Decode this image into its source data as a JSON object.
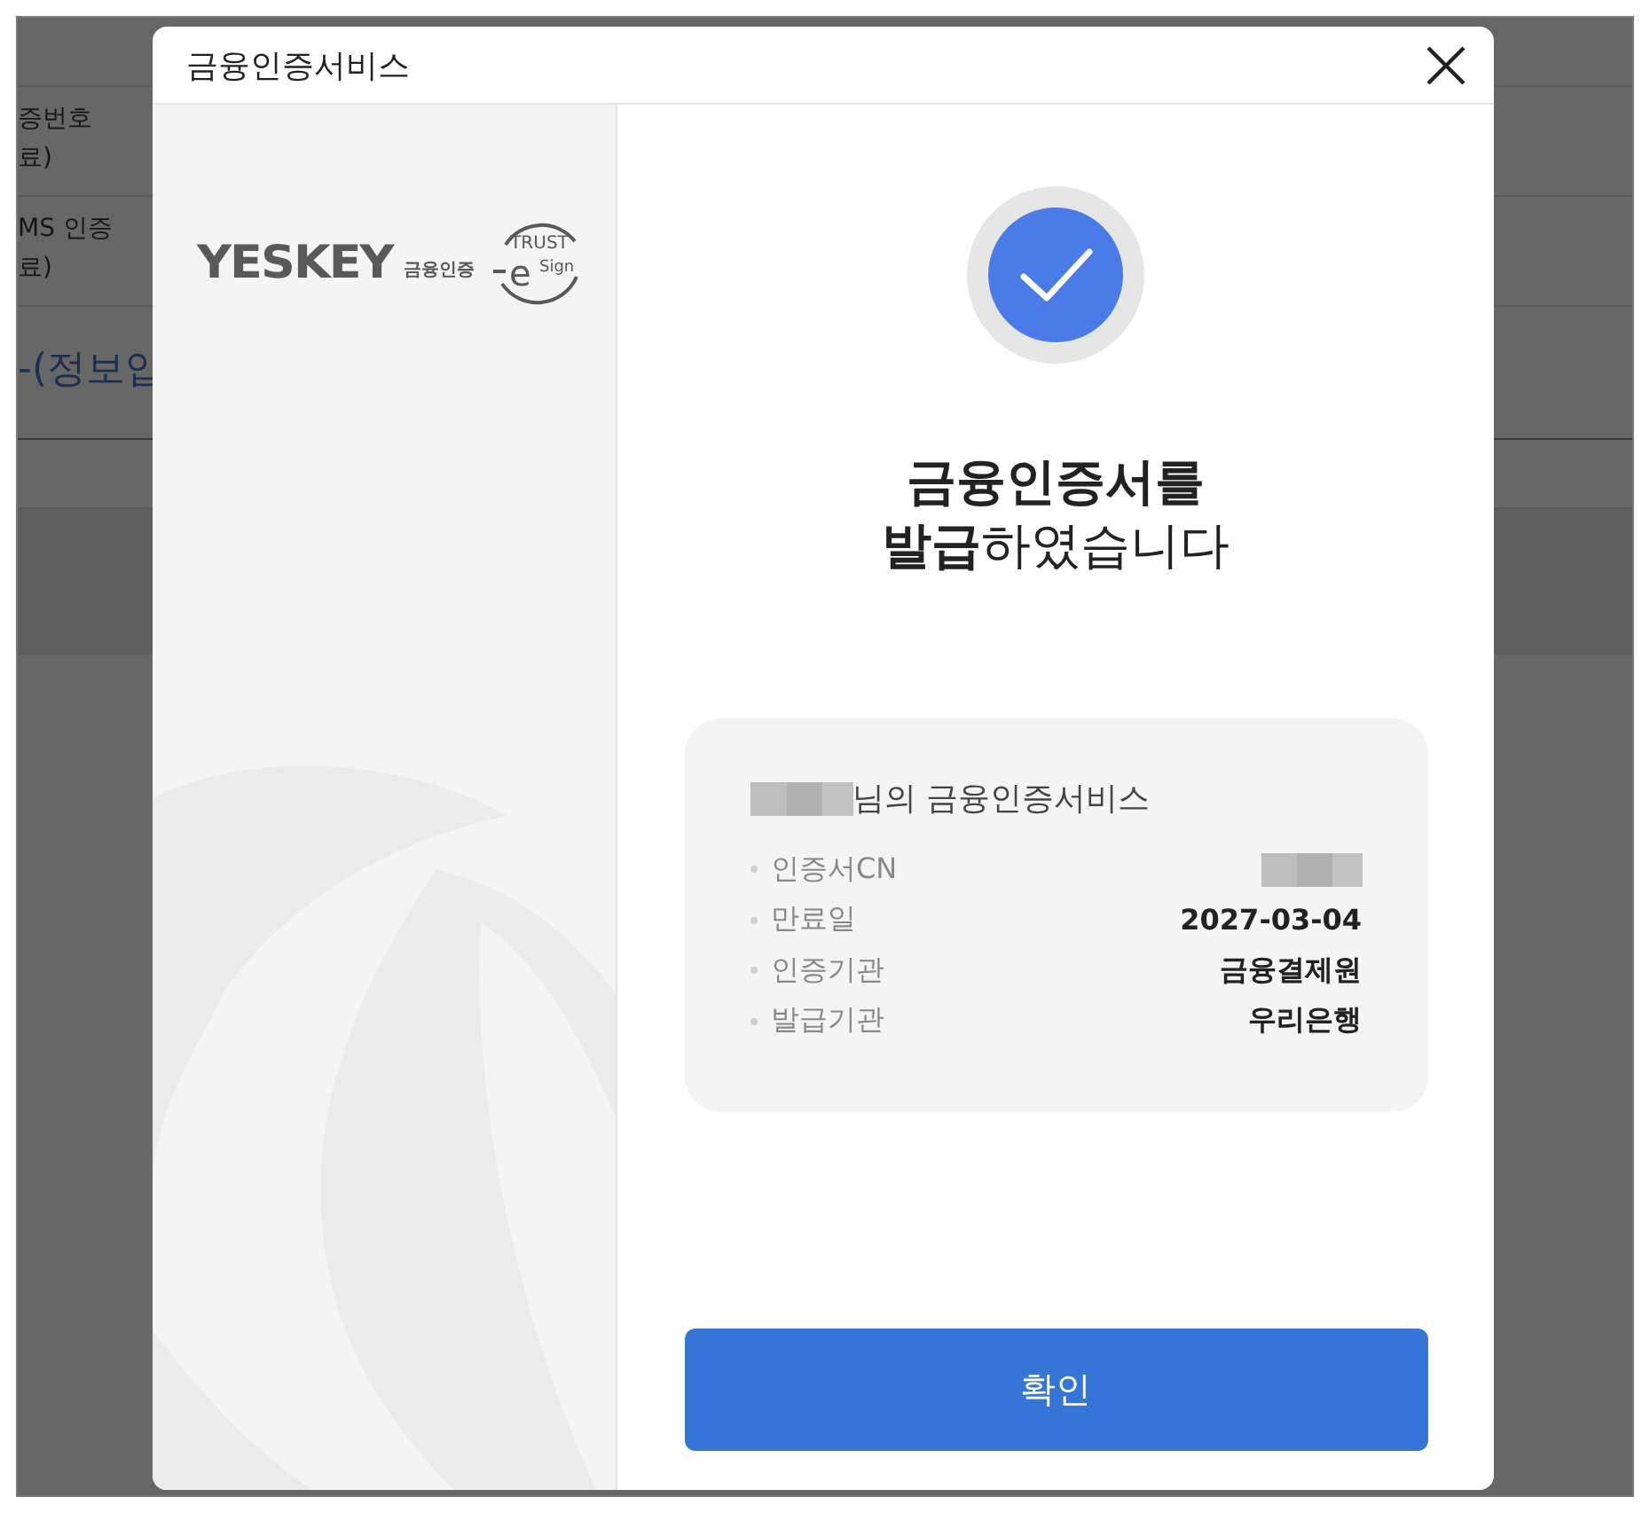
{
  "background_page": {
    "rows": [
      {
        "lines": [
          "증번호",
          "료)"
        ]
      },
      {
        "lines": [
          "MS 인증",
          "료)"
        ]
      },
      {
        "lines": [
          "-(정보입"
        ],
        "kind": "heading"
      }
    ]
  },
  "dialog": {
    "title": "금융인증서비스",
    "logo": {
      "wordmark": "YESKEY",
      "sub": "금융인증",
      "seal_top": "TRUST",
      "seal_letter": "e",
      "seal_bottom": "Sign"
    },
    "heading": [
      "금융인증서를",
      "**발급**하였습니다"
    ],
    "card": {
      "owner_suffix": "님의 금융인증서비스",
      "rows": [
        {
          "label": "인증서CN",
          "redacted": true
        },
        {
          "label": "만료일",
          "value": "2027-03-04",
          "redacted": false
        },
        {
          "label": "인증기관",
          "value": "금융결제원",
          "redacted": false
        },
        {
          "label": "발급기관",
          "value": "우리은행",
          "redacted": false
        }
      ]
    },
    "confirm_button": "확인"
  }
}
